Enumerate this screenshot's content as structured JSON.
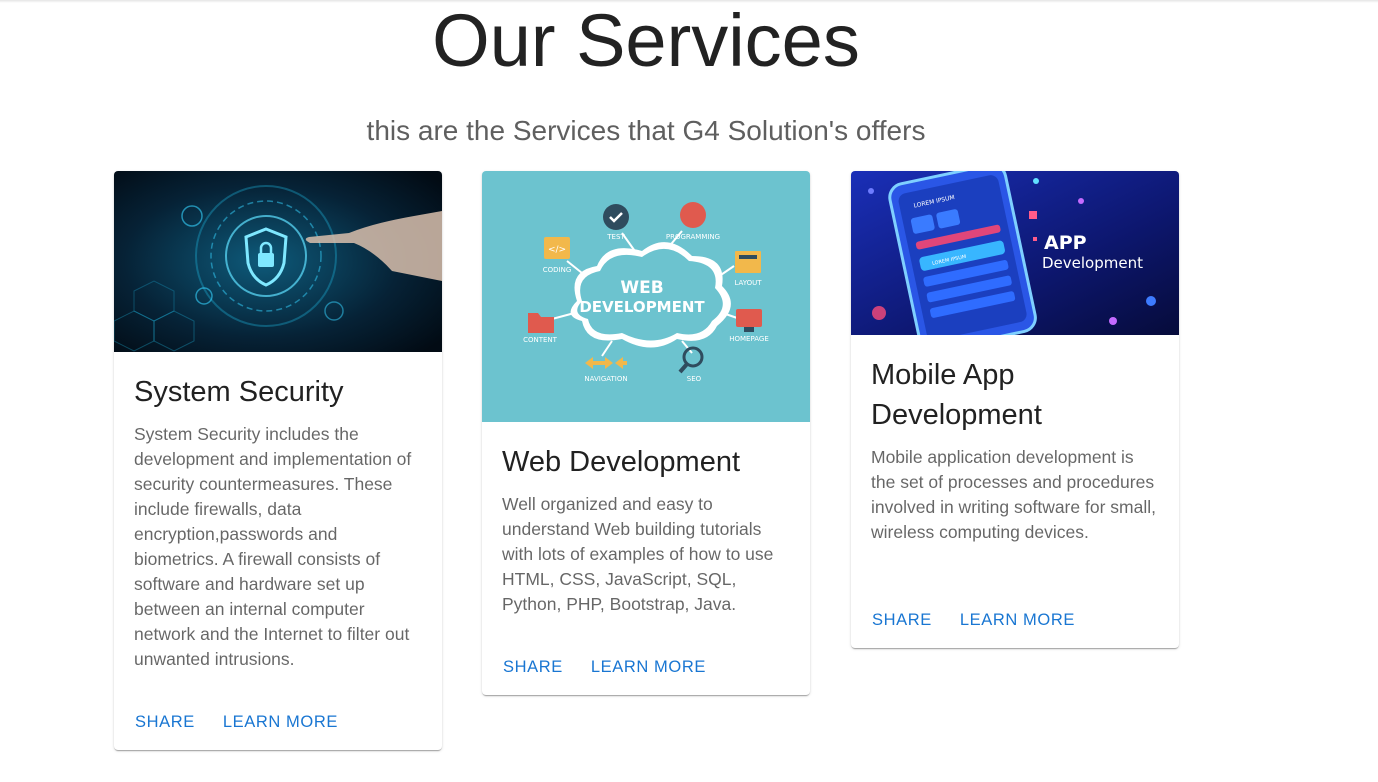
{
  "header": {
    "title": "Our Services",
    "subtitle": "this are the Services that G4 Solution's offers"
  },
  "colors": {
    "accent": "#1976d2"
  },
  "cards": [
    {
      "title": "System Security",
      "text": "System Security includes the development and implementation of security countermeasures. These include firewalls, data encryption,passwords and biometrics. A firewall consists of software and hardware set up between an internal computer network and the Internet to filter out unwanted intrusions.",
      "share": "SHARE",
      "learn": "LEARN MORE",
      "image_icon": "security-image"
    },
    {
      "title": "Web Development",
      "text": "Well organized and easy to understand Web building tutorials with lots of examples of how to use HTML, CSS, JavaScript, SQL, Python, PHP, Bootstrap, Java.",
      "share": "SHARE",
      "learn": "LEARN MORE",
      "image_icon": "web-development-image",
      "image_labels": {
        "cloud_line1": "WEB",
        "cloud_line2": "DEVELOPMENT",
        "test": "TEST",
        "programming": "PROGRAMMING",
        "coding": "CODING",
        "layout": "LAYOUT",
        "content": "CONTENT",
        "homepage": "HOMEPAGE",
        "navigation": "NAVIGATION",
        "seo": "SEO"
      }
    },
    {
      "title": "Mobile App Development",
      "text": "Mobile application development is the set of processes and procedures involved in writing software for small, wireless computing devices.",
      "share": "SHARE",
      "learn": "LEARN MORE",
      "image_icon": "mobile-app-image",
      "image_labels": {
        "line1": "APP",
        "line2": "Development",
        "phone_header": "LOREM IPSUM",
        "phone_row": "LOREM IPSUM"
      }
    }
  ]
}
